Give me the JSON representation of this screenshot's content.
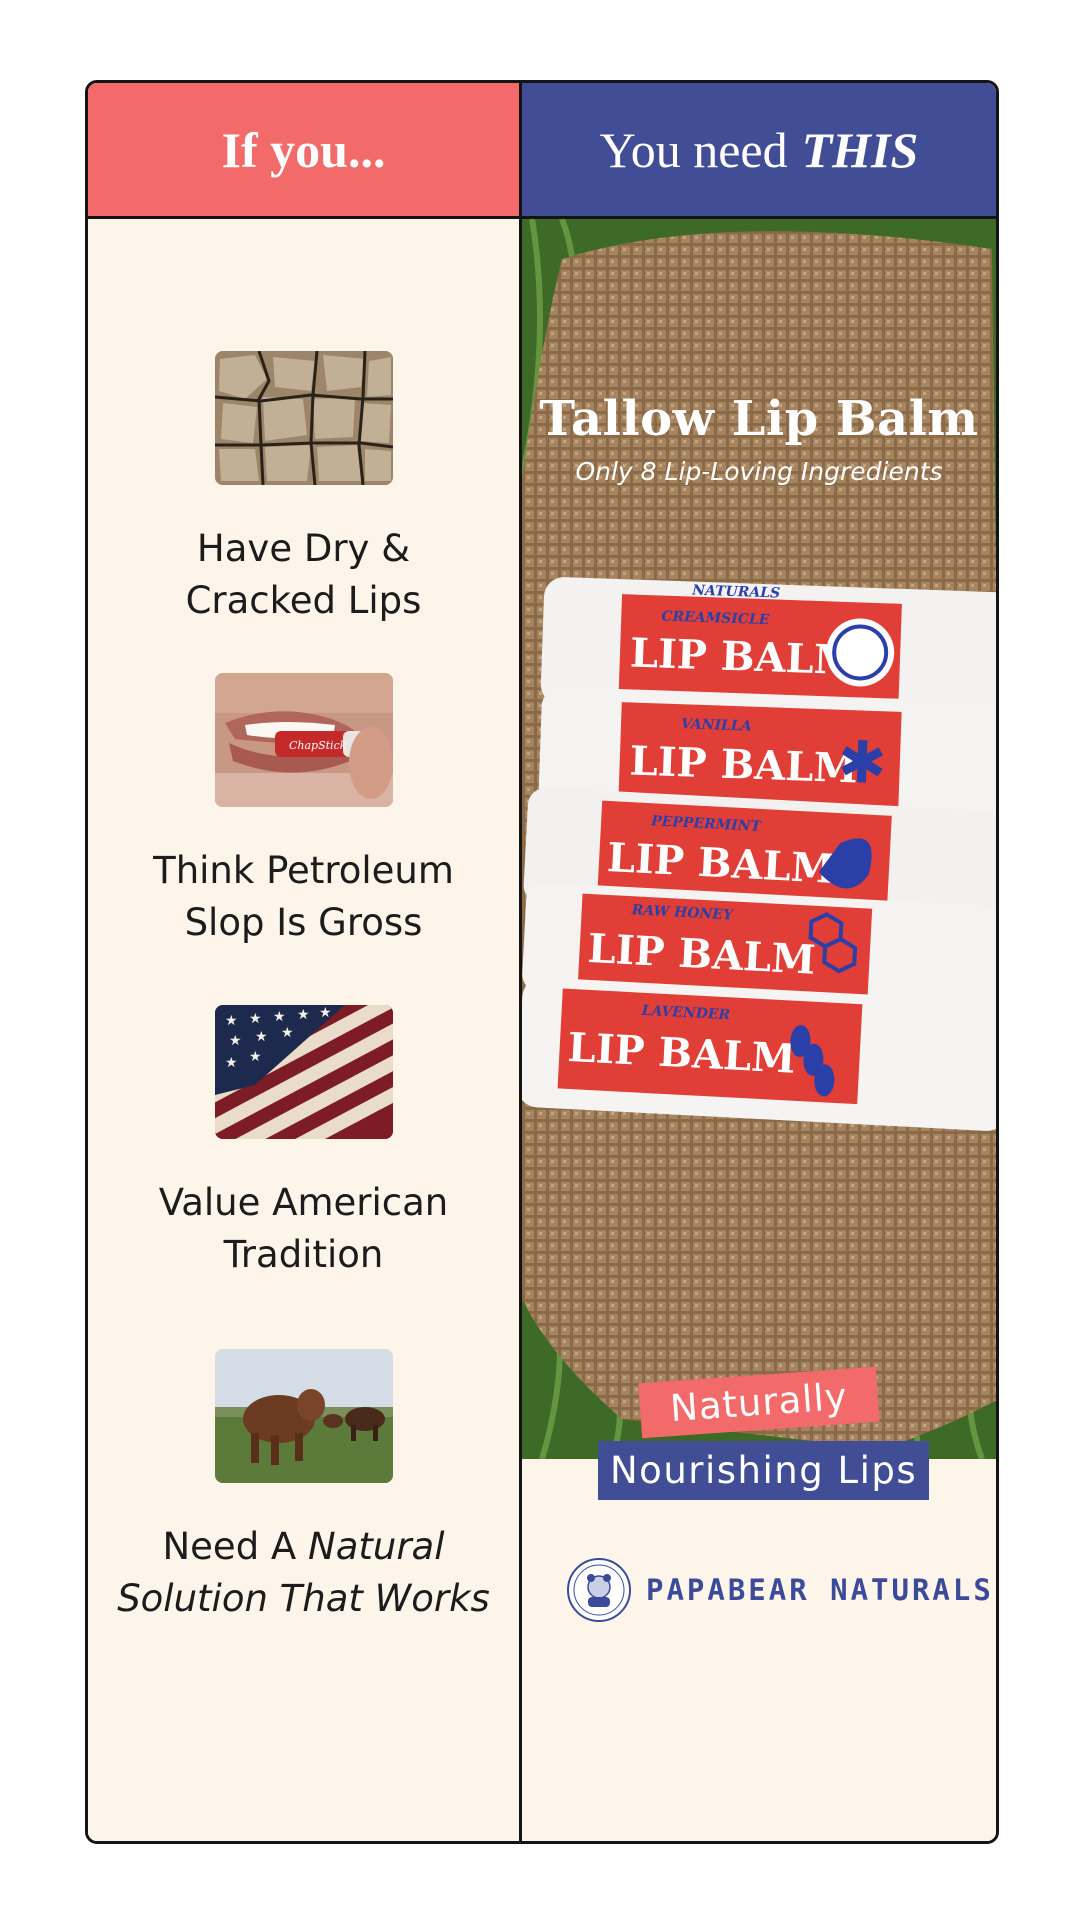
{
  "header": {
    "left_title": "If you...",
    "right_title_prefix": "You need",
    "right_title_emphasis": "THIS"
  },
  "left_items": [
    {
      "line1": "Have Dry &",
      "line2": "Cracked Lips",
      "image": "cracked-earth-image"
    },
    {
      "line1": "Think Petroleum",
      "line2": "Slop Is Gross",
      "image": "chapstick-lips-image",
      "brand_on_tube": "ChapStick"
    },
    {
      "line1": "Value American",
      "line2": "Tradition",
      "image": "american-flag-image"
    },
    {
      "line1_normal": "Need A ",
      "line1_italic": "Natural",
      "line2_italic": "Solution That Works",
      "image": "cattle-field-image"
    }
  ],
  "product": {
    "title": "Tallow Lip Balm",
    "subtitle": "Only 8 Lip-Loving Ingredients",
    "brand_on_stick": "NATURALS",
    "sticks": [
      {
        "flavor": "CREAMSICLE",
        "label": "LIP BALM",
        "icon": "orange-slice-icon"
      },
      {
        "flavor": "VANILLA",
        "label": "LIP BALM",
        "icon": "vanilla-flower-icon"
      },
      {
        "flavor": "PEPPERMINT",
        "label": "LIP BALM",
        "icon": "mint-leaf-icon"
      },
      {
        "flavor": "RAW HONEY",
        "label": "LIP BALM",
        "icon": "honeycomb-icon"
      },
      {
        "flavor": "LAVENDER",
        "label": "LIP BALM",
        "icon": "lavender-sprig-icon"
      }
    ]
  },
  "tagline": {
    "line1": "Naturally",
    "line2": "Nourishing Lips"
  },
  "brand": {
    "name": "PAPABEAR NATURALS",
    "logo": "bear-badge-icon"
  },
  "colors": {
    "coral": "#f26a6a",
    "navy": "#414e95",
    "cream": "#fdf5e9",
    "border": "#141414"
  }
}
